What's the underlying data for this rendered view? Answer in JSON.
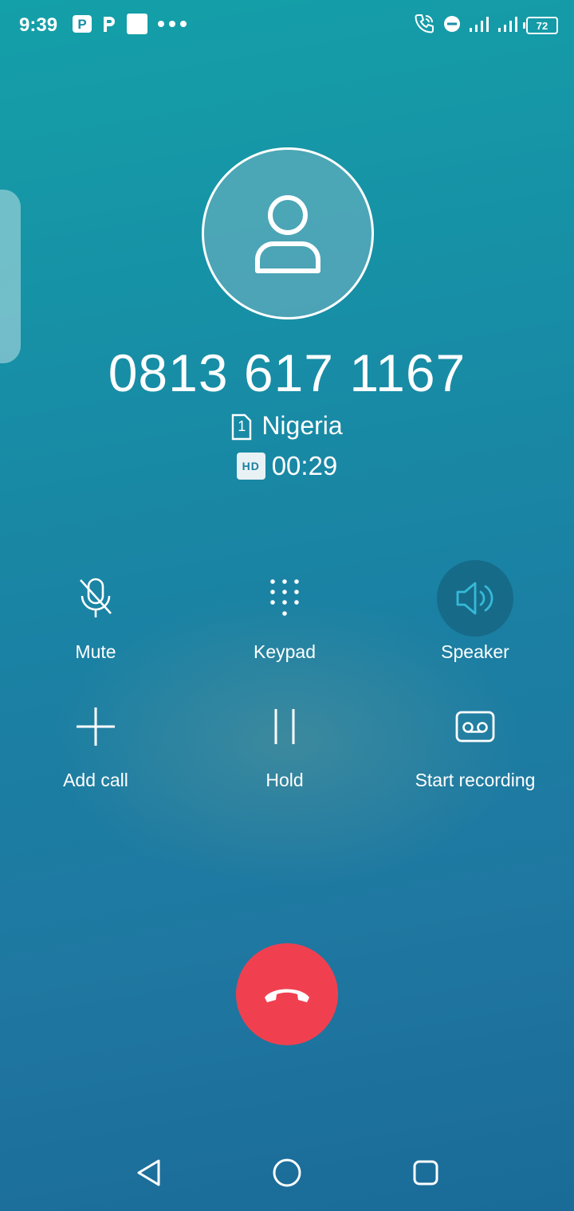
{
  "status_bar": {
    "time": "9:39",
    "notification_icons": [
      "p-app-icon",
      "p-icon",
      "square-icon",
      "more-dots-icon"
    ],
    "system_icons": [
      "wifi-calling-icon",
      "dnd-icon",
      "signal-icon",
      "signal-icon"
    ],
    "battery": "72"
  },
  "call": {
    "number": "0813 617 1167",
    "sim": "1",
    "location": "Nigeria",
    "hd": "HD",
    "duration": "00:29"
  },
  "controls": {
    "mute": "Mute",
    "keypad": "Keypad",
    "speaker": "Speaker",
    "add_call": "Add call",
    "hold": "Hold",
    "start_recording": "Start recording"
  },
  "colors": {
    "end_call": "#f04050",
    "speaker_active": "#36b9d8"
  }
}
